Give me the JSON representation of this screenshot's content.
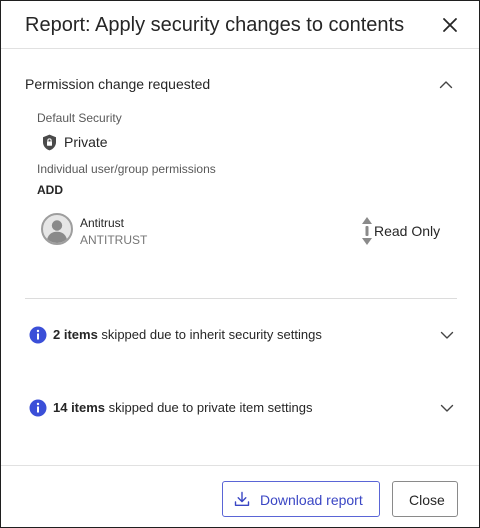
{
  "dialog": {
    "title": "Report: Apply security changes to contents",
    "close_icon": "close-icon"
  },
  "permission_section": {
    "title": "Permission change requested",
    "expanded": true,
    "default_security_label": "Default Security",
    "default_security_value": "Private",
    "default_security_icon": "shield-lock-icon",
    "individual_label": "Individual user/group permissions",
    "action_label": "ADD",
    "users": [
      {
        "name": "Antitrust",
        "subtitle": "ANTITRUST",
        "avatar_icon": "user-avatar-icon",
        "permission": "Read Only"
      }
    ]
  },
  "skipped": [
    {
      "count_label": "2 items",
      "text": " skipped due to inherit security settings",
      "expanded": false
    },
    {
      "count_label": "14 items",
      "text": " skipped due to private item settings",
      "expanded": false
    }
  ],
  "footer": {
    "download_label": "Download report",
    "download_icon": "download-icon",
    "close_label": "Close"
  },
  "colors": {
    "accent": "#3a46c4",
    "info": "#3b4fd8",
    "text": "#262626",
    "muted": "#595959"
  }
}
